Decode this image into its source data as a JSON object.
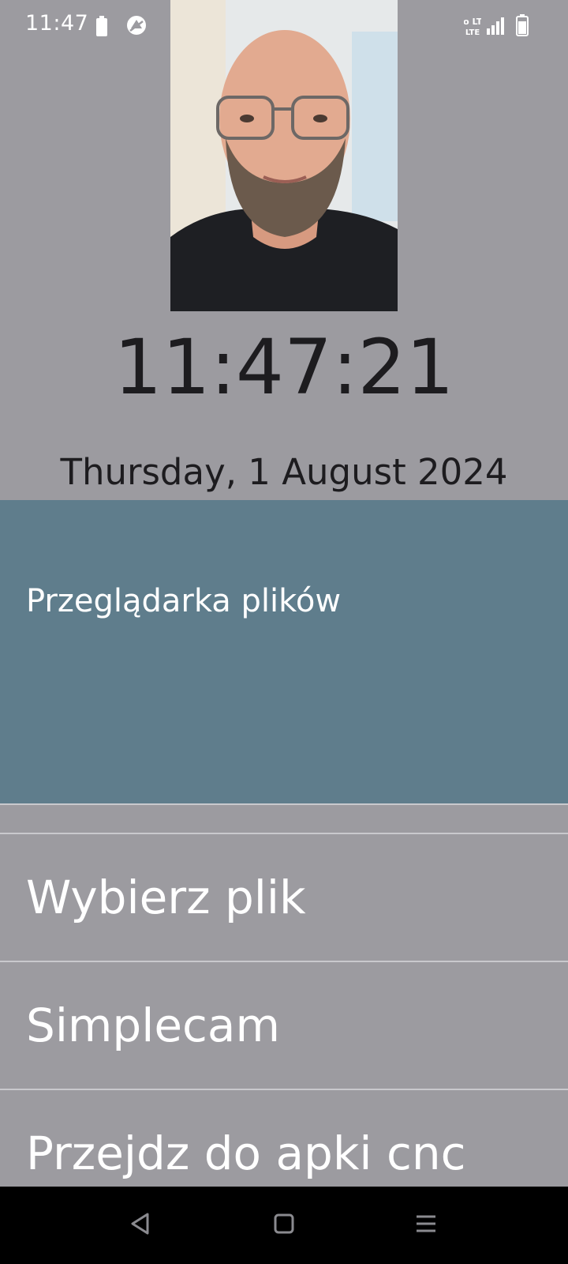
{
  "status_bar": {
    "time": "11:47",
    "icons": [
      "battery-saver-icon",
      "vpn-icon",
      "volte-icon",
      "signal-icon",
      "battery-icon"
    ],
    "volte_text": "Vo LTE"
  },
  "photo": {
    "icon": "user-photo"
  },
  "clock": {
    "time": "11:47:21"
  },
  "date": {
    "text": "Thursday, 1 August 2024"
  },
  "header": {
    "title": "Przeglądarka plików",
    "color": "#5f7d8c"
  },
  "menu": {
    "items": [
      {
        "label": "Wybierz plik"
      },
      {
        "label": "Simplecam"
      },
      {
        "label": "Przejdz do apki cnc"
      }
    ]
  },
  "nav_bar": {
    "icons": [
      "back-icon",
      "home-icon",
      "menu-icon"
    ]
  },
  "colors": {
    "background": "#9c9ba0",
    "text_dark": "#1d1c1f",
    "text_light": "#ffffff"
  }
}
